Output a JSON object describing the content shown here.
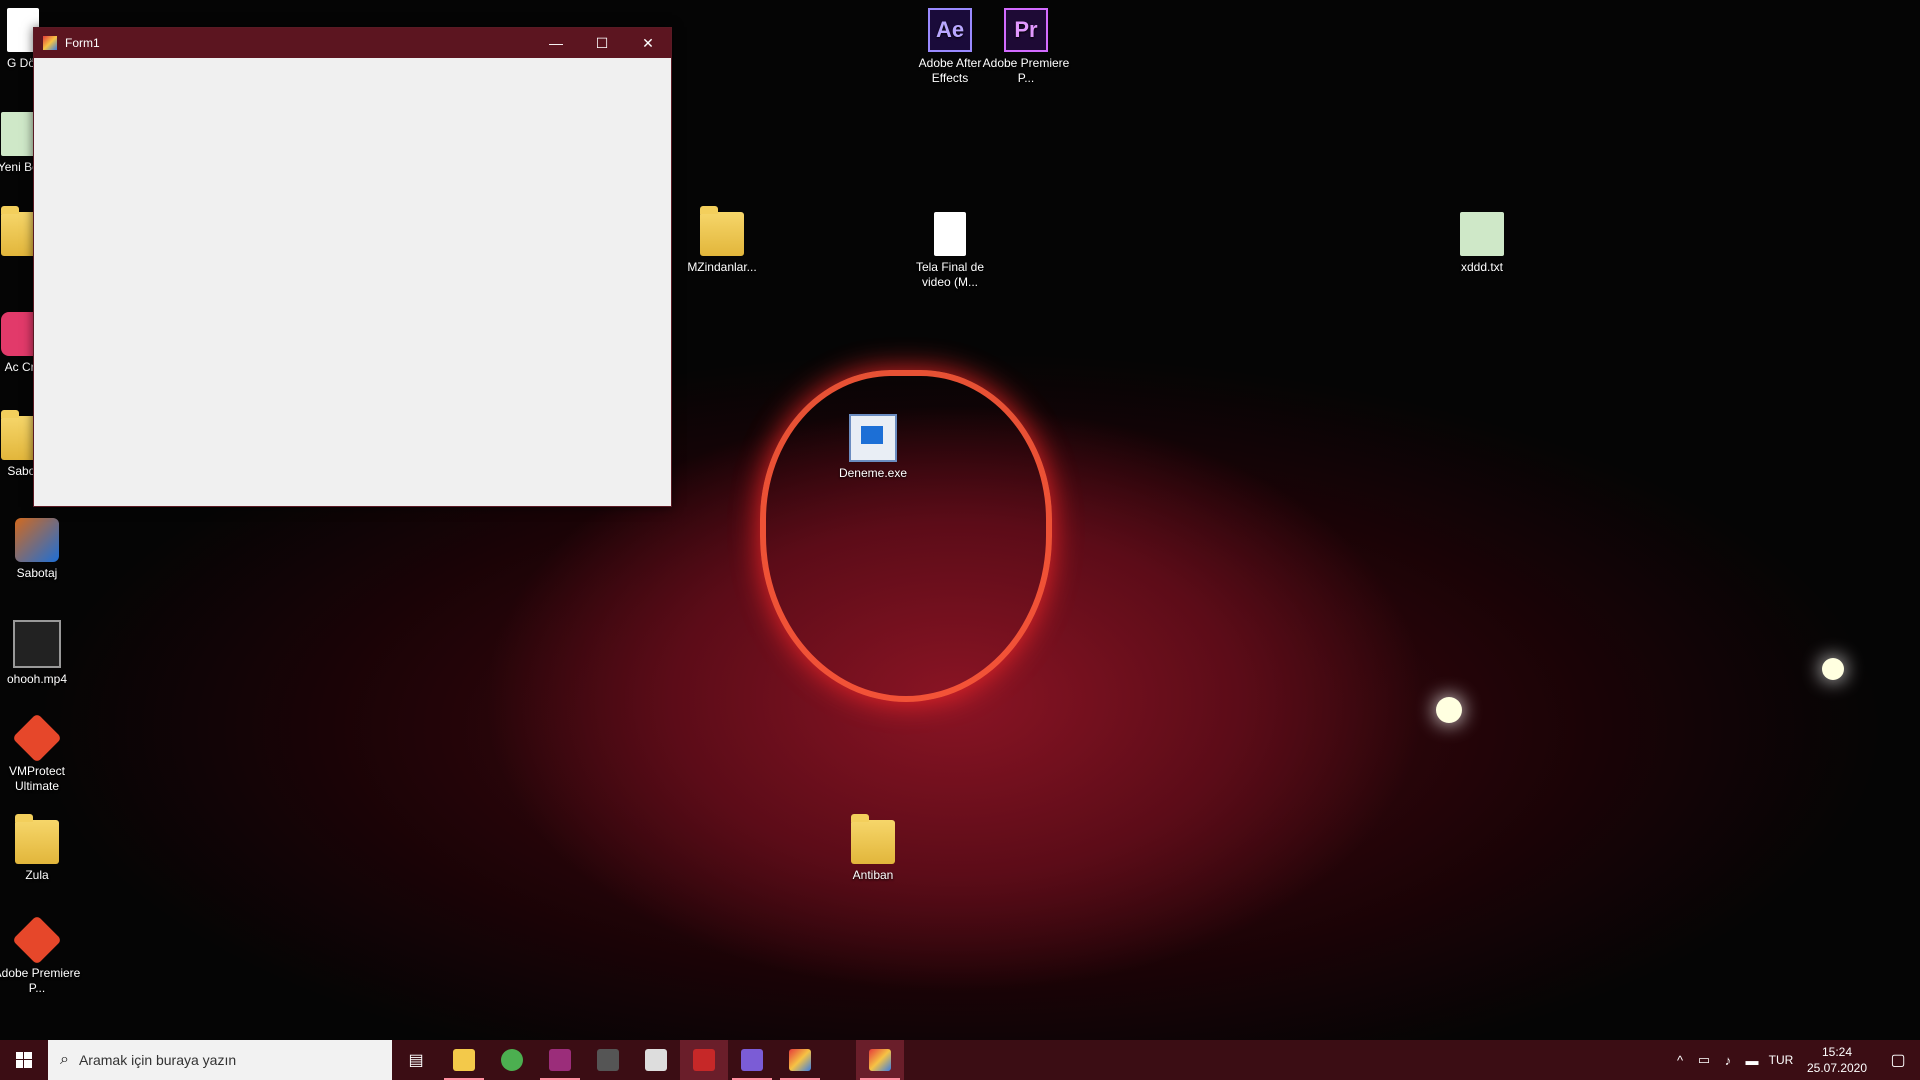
{
  "desktop": {
    "icons": {
      "after_effects": "Adobe After Effects",
      "premiere_top": "Adobe Premiere P...",
      "mzindanlar": "MZindanlar...",
      "tela_final": "Tela Final de video (M...",
      "xddd": "xddd.txt",
      "deneme": "Deneme.exe",
      "antiban": "Antiban",
      "sabotaj": "Sabotaj",
      "ohooh": "ohooh.mp4",
      "vmprotect": "VMProtect Ultimate",
      "zula": "Zula",
      "premiere_bottom": "Adobe Premiere P...",
      "partial_1": "G Dör",
      "partial_2": "Yeni Belg",
      "partial_3": "Ac Cre",
      "partial_4": "Sabot"
    },
    "icon_glyphs": {
      "ae": "Ae",
      "pr": "Pr"
    }
  },
  "window": {
    "title": "Form1",
    "minimize": "—",
    "maximize": "☐",
    "close": "✕"
  },
  "taskbar": {
    "search_placeholder": "Aramak için buraya yazın",
    "language": "TUR",
    "time": "15:24",
    "date": "25.07.2020",
    "apps": [
      "task-view",
      "file-explorer",
      "chrome",
      "winrar",
      "ttg",
      "app-window",
      "flash",
      "visual-studio",
      "form-app",
      "form1-running"
    ]
  },
  "colors": {
    "titlebar": "#5c1520",
    "taskbar": "#3b0d14"
  }
}
